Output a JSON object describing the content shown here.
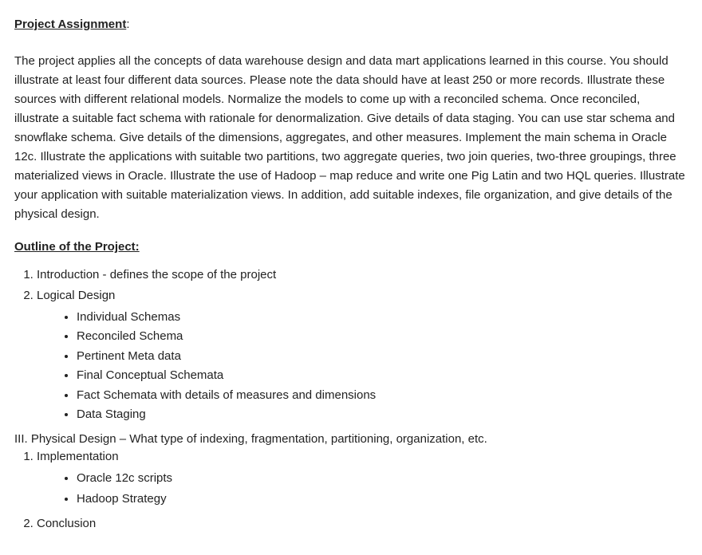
{
  "header": {
    "title": "Project Assignment",
    "colon": ":"
  },
  "description": "The project applies all the concepts of data warehouse design and data mart applications learned in this course. You should illustrate at least four different data sources. Please note the data should have at least 250 or more records.  Illustrate these sources with different relational models.  Normalize the models to come up with a reconciled schema.   Once reconciled, illustrate a suitable fact schema with rationale for denormalization.   Give details of data staging.  You can use star schema and snowflake schema.   Give details of the dimensions, aggregates, and other measures. Implement the main schema in Oracle 12c.   Illustrate the applications with suitable two partitions, two aggregate queries, two join queries, two-three groupings, three materialized views in Oracle.  Illustrate the use of Hadoop – map reduce and write one Pig Latin and two HQL queries.  Illustrate your application with suitable materialization views.  In addition, add suitable indexes, file organization, and give details of the physical design.",
  "outline": {
    "title": "Outline of the Project:",
    "numbered_items": [
      {
        "label": "Introduction - defines the scope of the project",
        "sub_bullets": []
      },
      {
        "label": "Logical Design",
        "sub_bullets": [
          "Individual Schemas",
          "Reconciled Schema",
          "Pertinent Meta data",
          "Final Conceptual Schemata",
          "Fact Schemata with details of measures and dimensions",
          "Data Staging"
        ]
      }
    ],
    "roman_items": [
      {
        "label": "III.  Physical Design – What type of indexing, fragmentation, partitioning, organization, etc.",
        "numbered_sub": [
          {
            "label": "Implementation",
            "sub_bullets": [
              "Oracle 12c scripts",
              "Hadoop Strategy"
            ]
          },
          {
            "label": "Conclusion",
            "sub_bullets": []
          }
        ]
      }
    ]
  }
}
